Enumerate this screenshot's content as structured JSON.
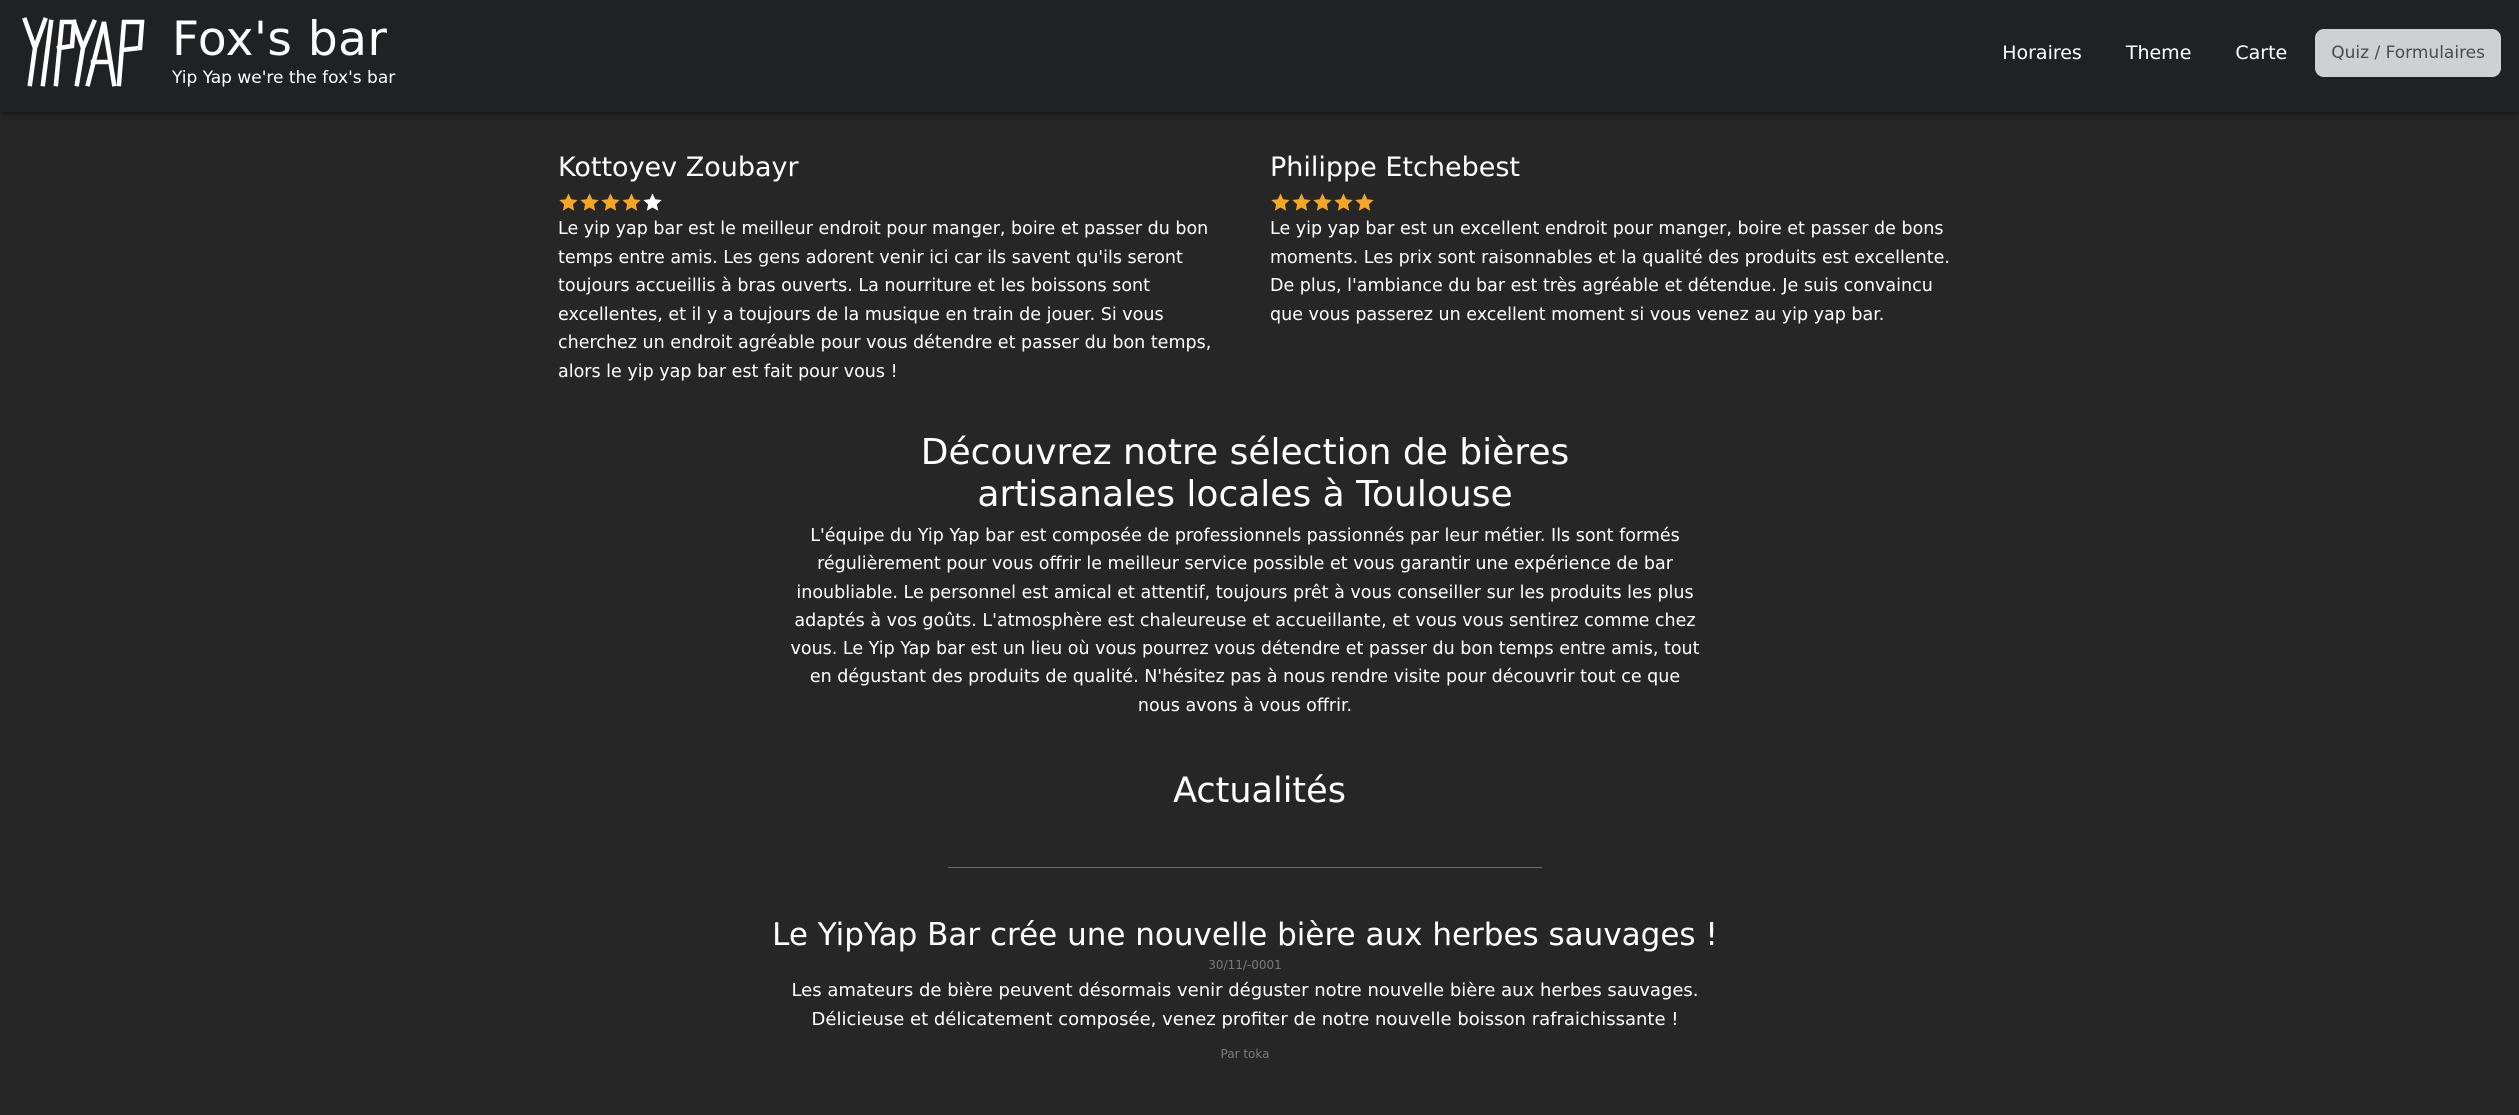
{
  "header": {
    "logo_text": "YIPYAP",
    "title": "Fox's bar",
    "subtitle": "Yip Yap we're the fox's bar",
    "nav": {
      "horaires": "Horaires",
      "theme": "Theme",
      "carte": "Carte",
      "quiz": "Quiz / Formulaires"
    }
  },
  "reviews": [
    {
      "name": "Kottoyev Zoubayr",
      "rating": 4,
      "max_rating": 5,
      "text": "Le yip yap bar est le meilleur endroit pour manger, boire et passer du bon temps entre amis. Les gens adorent venir ici car ils savent qu'ils seront toujours accueillis à bras ouverts. La nourriture et les boissons sont excellentes, et il y a toujours de la musique en train de jouer. Si vous cherchez un endroit agréable pour vous détendre et passer du bon temps, alors le yip yap bar est fait pour vous !"
    },
    {
      "name": "Philippe Etchebest",
      "rating": 5,
      "max_rating": 5,
      "text": "Le yip yap bar est un excellent endroit pour manger, boire et passer de bons moments. Les prix sont raisonnables et la qualité des produits est excellente. De plus, l'ambiance du bar est très agréable et détendue. Je suis convaincu que vous passerez un excellent moment si vous venez au yip yap bar."
    }
  ],
  "feature": {
    "title": "Découvrez notre sélection de bières artisanales locales à Toulouse",
    "text": "L'équipe du Yip Yap bar est composée de professionnels passionnés par leur métier. Ils sont formés régulièrement pour vous offrir le meilleur service possible et vous garantir une expérience de bar inoubliable. Le personnel est amical et attentif, toujours prêt à vous conseiller sur les produits les plus adaptés à vos goûts. L'atmosphère est chaleureuse et accueillante, et vous vous sentirez comme chez vous. Le Yip Yap bar est un lieu où vous pourrez vous détendre et passer du bon temps entre amis, tout en dégustant des produits de qualité. N'hésitez pas à nous rendre visite pour découvrir tout ce que nous avons à vous offrir."
  },
  "news": {
    "heading": "Actualités",
    "article": {
      "title": "Le YipYap Bar crée une nouvelle bière aux herbes sauvages !",
      "date": "30/11/-0001",
      "text_line1": "Les amateurs de bière peuvent désormais venir déguster notre nouvelle bière aux herbes sauvages.",
      "text_line2": "Délicieuse et délicatement composée, venez profiter de notre nouvelle boisson rafraichissante !",
      "author": "Par toka"
    }
  },
  "colors": {
    "background": "#262626",
    "navbar": "#1f2122",
    "star_filled": "#f5a623",
    "star_empty": "#ffffff",
    "button_bg": "#cfd0d1"
  },
  "icons": {
    "star": "star-icon",
    "logo": "yipyap-logo"
  }
}
